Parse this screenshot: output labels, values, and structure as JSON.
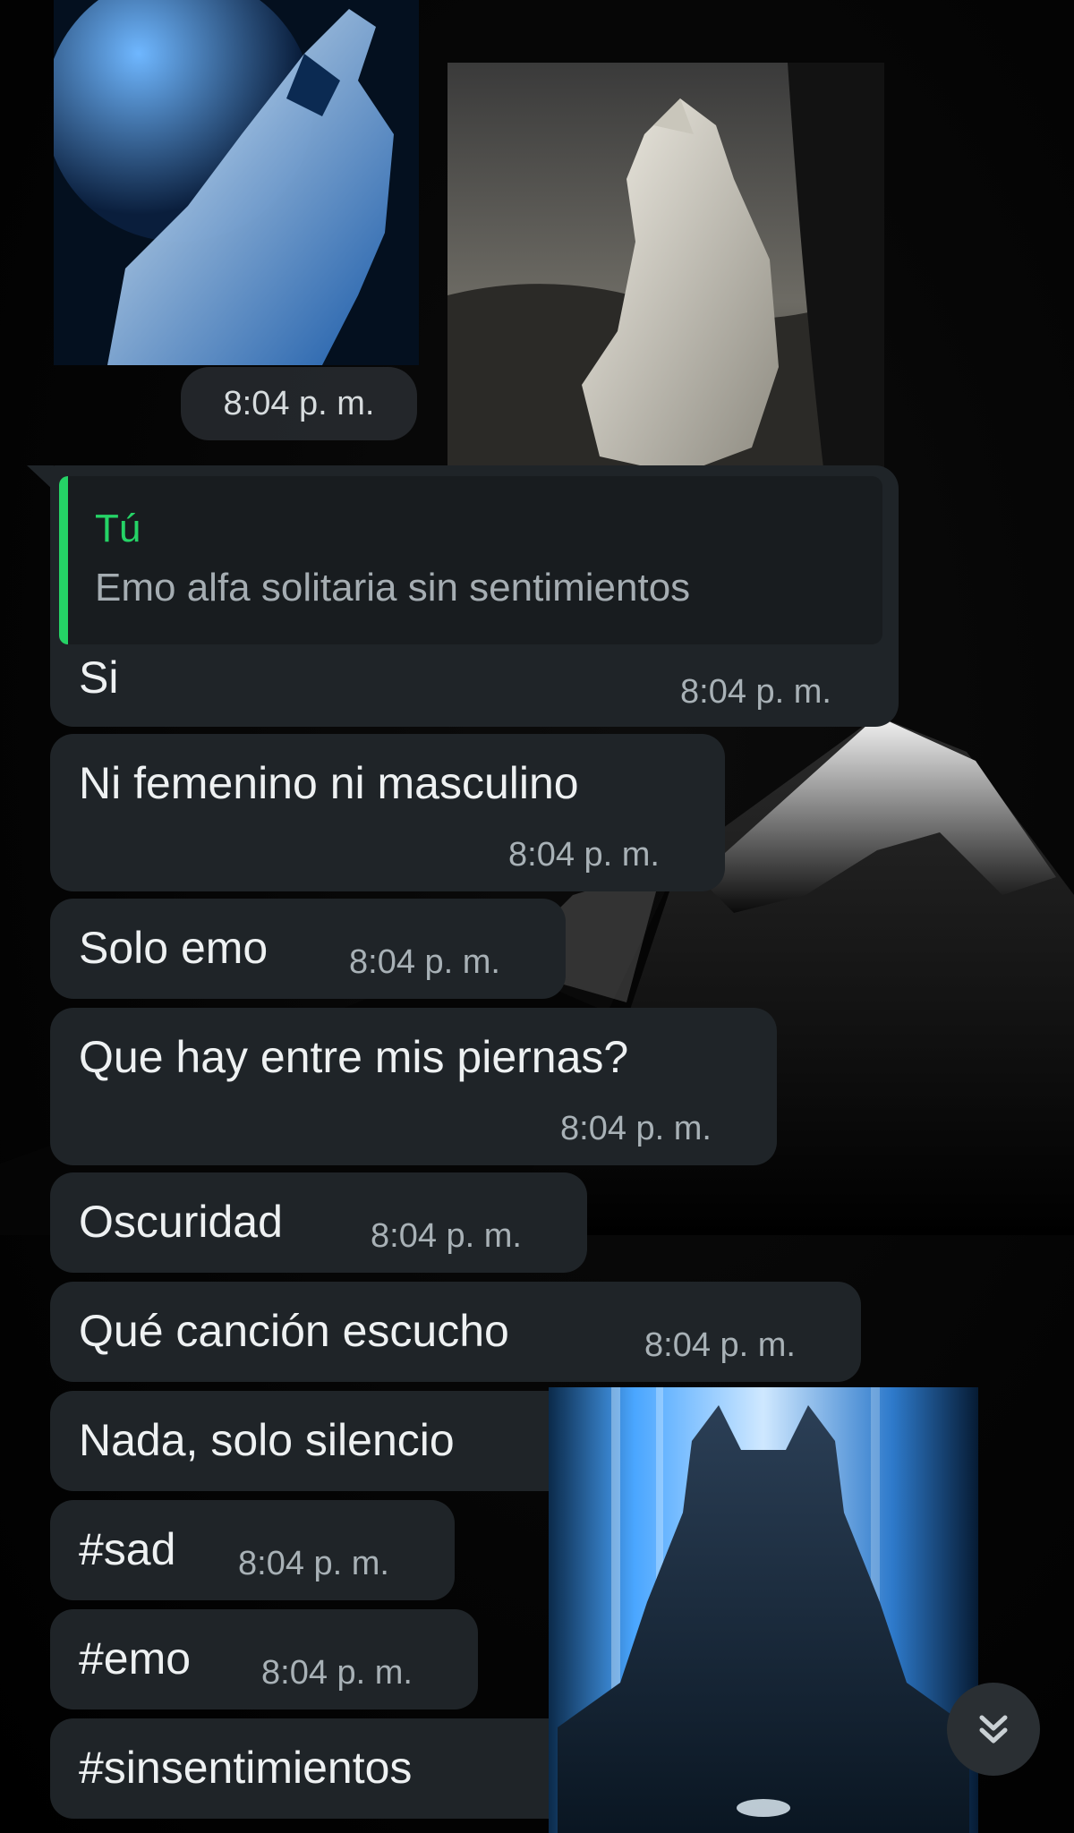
{
  "images": {
    "wolf_howling": {
      "label": ""
    },
    "wolf_sitting": {
      "label": ""
    },
    "wolf_crying": {
      "label": ""
    }
  },
  "first_time": "8:04 p. m.",
  "reply": {
    "quoted_author": "Tú",
    "quoted_text": "Emo alfa solitaria sin sentimientos",
    "text": "Si",
    "time": "8:04 p. m."
  },
  "messages": [
    {
      "text": "Ni femenino ni masculino",
      "time": "8:04 p. m."
    },
    {
      "text": "Solo emo",
      "time": "8:04 p. m."
    },
    {
      "text": "Que hay entre mis piernas?",
      "time": "8:04 p. m."
    },
    {
      "text": "Oscuridad",
      "time": "8:04 p. m."
    },
    {
      "text": "Qué canción escucho",
      "time": "8:04 p. m."
    },
    {
      "text": "Nada, solo silencio",
      "time": ""
    },
    {
      "text": "#sad",
      "time": "8:04 p. m."
    },
    {
      "text": "#emo",
      "time": "8:04 p. m."
    },
    {
      "text": "#sinsentimientos",
      "time": ""
    }
  ],
  "icons": {
    "scroll_down": "double-chevron-down-icon"
  },
  "colors": {
    "bubble": "#1f2428",
    "quote_accent": "#25d366",
    "text": "#eef1f2",
    "time": "#a8b1b6"
  }
}
